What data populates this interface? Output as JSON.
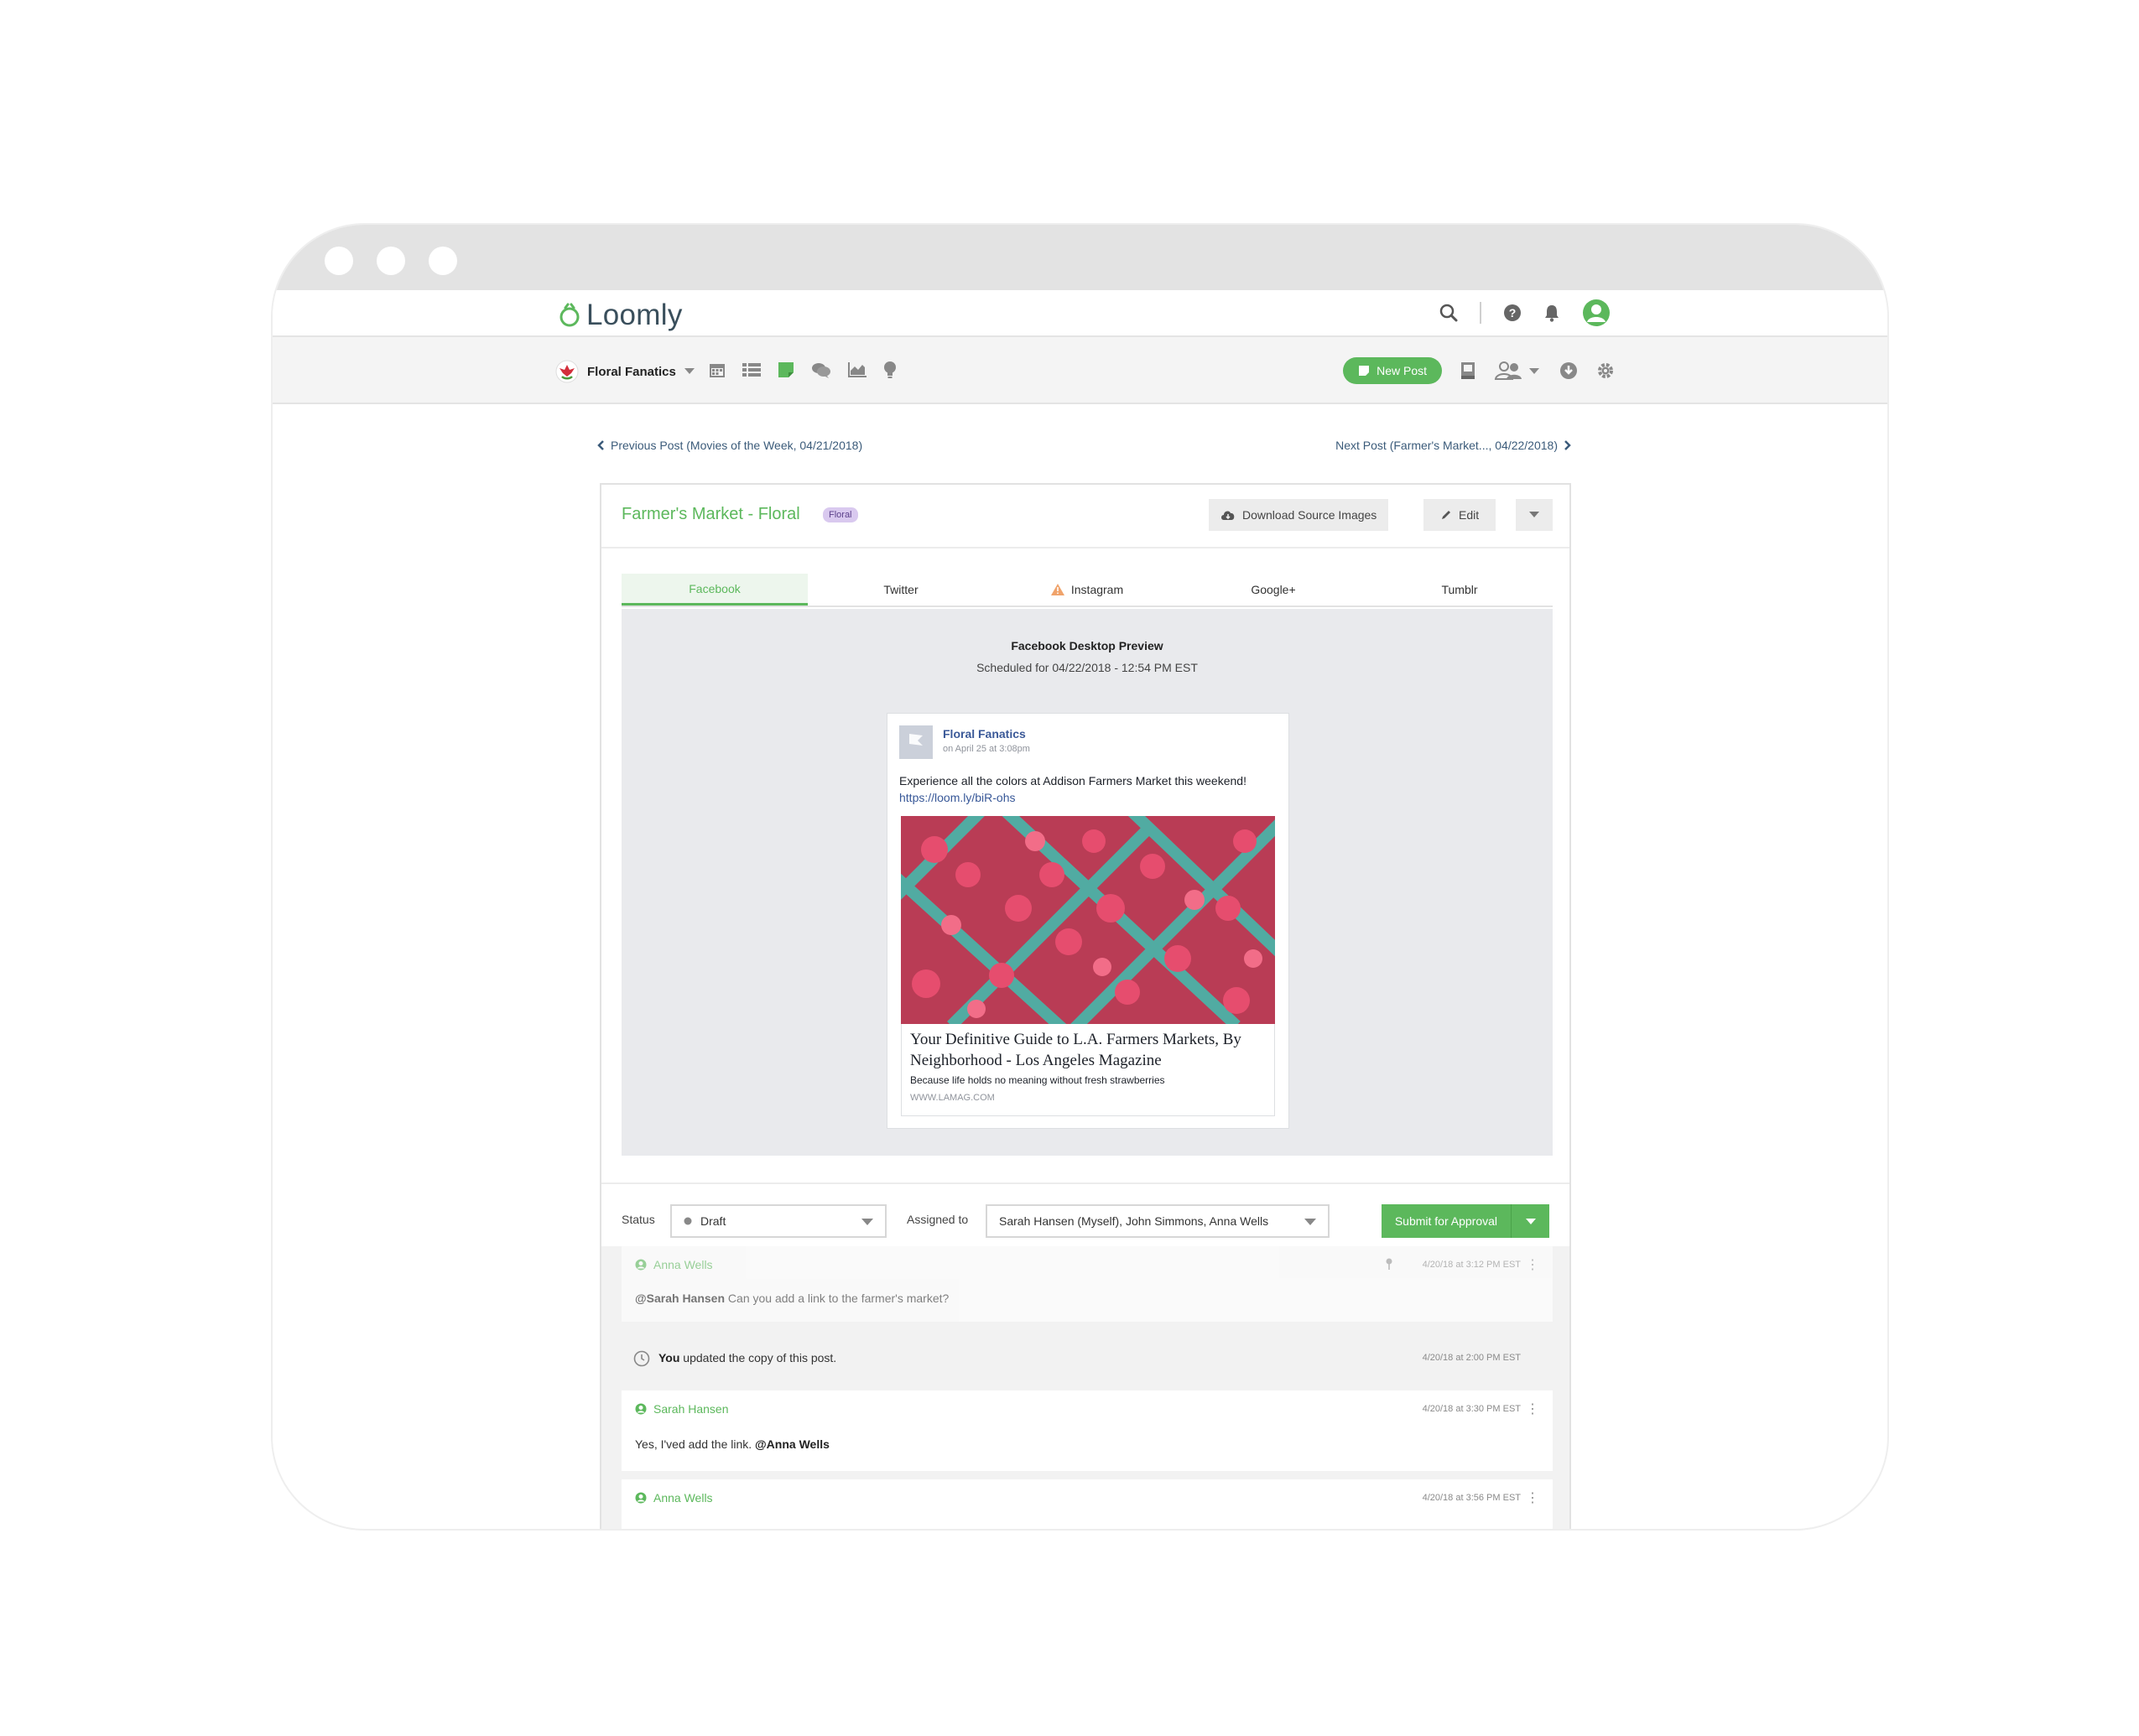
{
  "app": {
    "name": "Loomly"
  },
  "brand": {
    "name": "Floral Fanatics"
  },
  "header": {
    "new_post_label": "New Post"
  },
  "post_nav": {
    "previous": "Previous Post (Movies of the Week, 04/21/2018)",
    "next": "Next Post (Farmer's Market..., 04/22/2018)"
  },
  "post": {
    "title": "Farmer's Market - Floral",
    "tag": "Floral",
    "download_label": "Download Source Images",
    "edit_label": "Edit"
  },
  "tabs": [
    {
      "label": "Facebook",
      "active": true
    },
    {
      "label": "Twitter"
    },
    {
      "label": "Instagram",
      "warning": true
    },
    {
      "label": "Google+"
    },
    {
      "label": "Tumblr"
    }
  ],
  "preview": {
    "title": "Facebook Desktop Preview",
    "scheduled": "Scheduled for 04/22/2018 - 12:54 PM EST",
    "fb": {
      "page_name": "Floral Fanatics",
      "date": "on April 25 at 3:08pm",
      "text": "Experience all the colors at Addison Farmers Market this weekend!",
      "link": "https://loom.ly/biR-ohs",
      "headline": "Your Definitive Guide to L.A. Farmers Markets, By Neighborhood - Los Angeles Magazine",
      "description": "Because life holds no meaning without fresh strawberries",
      "domain": "WWW.LAMAG.COM"
    }
  },
  "status": {
    "label": "Status",
    "value": "Draft",
    "assigned_label": "Assigned to",
    "assigned_value": "Sarah Hansen (Myself), John Simmons, Anna Wells",
    "submit_label": "Submit for Approval"
  },
  "comments": [
    {
      "author": "Anna Wells",
      "time": "4/20/18 at 3:12 PM EST",
      "mention": "@Sarah Hansen",
      "text": " Can you add a link to the farmer's market?"
    },
    {
      "activity_actor": "You",
      "activity_text": " updated the copy of this post.",
      "time": "4/20/18 at 2:00 PM EST"
    },
    {
      "author": "Sarah Hansen",
      "time": "4/20/18 at 3:30 PM EST",
      "text": "Yes, I'ved add the link. ",
      "mention": "@Anna Wells"
    },
    {
      "author": "Anna Wells",
      "time": "4/20/18 at 3:56 PM EST"
    }
  ],
  "colors": {
    "accent": "#5cb85c",
    "tag_bg": "#d9c9ef",
    "fb_blue": "#3b5998"
  }
}
